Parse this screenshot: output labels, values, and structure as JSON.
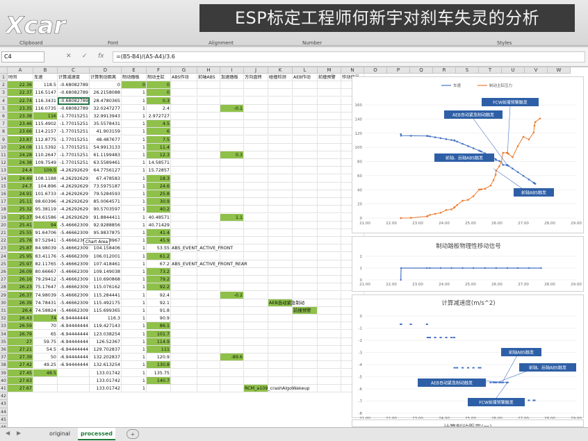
{
  "watermark": {
    "brand": "Xcar 爱卡",
    "title": "ESP标定工程师何新宇对刹车失灵的分析"
  },
  "ribbon": {
    "groups": [
      "Clipboard",
      "Font",
      "Alignment",
      "Number",
      "Styles"
    ]
  },
  "formula_bar": {
    "name_box": "C4",
    "cancel": "✕",
    "enter": "✓",
    "fx": "fx",
    "formula": "=(B5-B4)/(A5-A4)/3.6"
  },
  "columns": [
    "A",
    "B",
    "C",
    "D",
    "E",
    "F",
    "G",
    "H",
    "I",
    "J",
    "K",
    "L",
    "M",
    "N",
    "O",
    "P",
    "Q",
    "R",
    "S",
    "T",
    "U",
    "V",
    "W"
  ],
  "headers": [
    "时间",
    "车速",
    "计算减速度",
    "计算制动距离",
    "制动踏板",
    "制动主缸",
    "ABS作动",
    "前轴ABS",
    "加速踏板",
    "方向盘转",
    "碰撞检测",
    "AEB作动",
    "前撞预警",
    "作动信号"
  ],
  "rows": [
    {
      "a": "22.36",
      "b": "118.5",
      "c": "-0.68082789",
      "d": "0",
      "e": "0",
      "f": "0",
      "gA": 1,
      "gE": 1,
      "gF": 1
    },
    {
      "a": "22.37",
      "b": "116.5147",
      "c": "-0.68082789",
      "d": "26.2158088",
      "e": "1",
      "f": "0",
      "gA": 1,
      "gF": 1
    },
    {
      "a": "22.74",
      "b": "116.3431",
      "c": "-0.68082789",
      "d": "28.4780365",
      "e": "1",
      "f": "0.3",
      "gA": 1,
      "gF": 1
    },
    {
      "a": "23.35",
      "b": "116.0735",
      "c": "-0.68082789",
      "d": "32.0247277",
      "e": "1",
      "f": "2.4",
      "i": "-0.1",
      "gA": 1,
      "gI": 1
    },
    {
      "a": "23.38",
      "b": "116",
      "c": "-1.77015251",
      "d": "32.9913943",
      "e": "1",
      "f": "2.972727",
      "gA": 1,
      "gB": 1
    },
    {
      "a": "23.46",
      "b": "115.4902",
      "c": "-1.77015251",
      "d": "35.5578431",
      "e": "1",
      "f": "4.5",
      "gA": 1,
      "gF": 1
    },
    {
      "a": "23.66",
      "b": "114.2157",
      "c": "-1.77015251",
      "d": "41.903159",
      "e": "1",
      "f": "6",
      "gA": 1,
      "gF": 1
    },
    {
      "a": "23.87",
      "b": "112.8775",
      "c": "-1.77015251",
      "d": "48.487677",
      "e": "1",
      "f": "7.5",
      "gA": 1,
      "gF": 1
    },
    {
      "a": "24.08",
      "b": "111.5392",
      "c": "-1.77015251",
      "d": "54.9913133",
      "e": "1",
      "f": "11.4",
      "gA": 1,
      "gF": 1
    },
    {
      "a": "24.28",
      "b": "110.2647",
      "c": "-1.77015251",
      "d": "61.1199483",
      "e": "1",
      "f": "12.3",
      "i": "0.3",
      "gA": 1,
      "gF": 1,
      "gI": 1
    },
    {
      "a": "24.38",
      "b": "109.7549",
      "c": "-1.77015251",
      "d": "63.5589461",
      "e": "1",
      "f": "14.58571",
      "gA": 1
    },
    {
      "a": "24.4",
      "b": "109.5",
      "c": "-4.26292629",
      "d": "64.7756127",
      "e": "1",
      "f": "15.72857",
      "gA": 1,
      "gB": 1
    },
    {
      "a": "24.49",
      "b": "108.1188",
      "c": "-4.26292629",
      "d": "67.478583",
      "e": "1",
      "f": "18.3",
      "gA": 1,
      "gF": 1
    },
    {
      "a": "24.7",
      "b": "104.896",
      "c": "-4.26292629",
      "d": "73.5975187",
      "e": "1",
      "f": "24.6",
      "gA": 1,
      "gF": 1
    },
    {
      "a": "24.91",
      "b": "101.6733",
      "c": "-4.26292629",
      "d": "79.5284593",
      "e": "1",
      "f": "25.8",
      "gA": 1,
      "gF": 1
    },
    {
      "a": "25.11",
      "b": "98.60396",
      "c": "-4.26292629",
      "d": "85.0064571",
      "e": "1",
      "f": "30.9",
      "gA": 1,
      "gF": 1
    },
    {
      "a": "25.32",
      "b": "95.38119",
      "c": "-4.26292629",
      "d": "90.5703597",
      "e": "1",
      "f": "40.2",
      "gA": 1,
      "gF": 1
    },
    {
      "a": "25.37",
      "b": "94.61586",
      "c": "-4.26292629",
      "d": "91.8844411",
      "e": "1",
      "f": "40.48571",
      "i": "1.1",
      "gA": 1,
      "gI": 1
    },
    {
      "a": "25.41",
      "b": "94",
      "c": "-5.46662309",
      "d": "92.9288856",
      "e": "1",
      "f": "40.71429",
      "gA": 1,
      "gB": 1
    },
    {
      "a": "25.55",
      "b": "91.64706",
      "c": "-5.46662309",
      "d": "95.9837875",
      "e": "1",
      "f": "41.4",
      "gA": 1,
      "gF": 1
    },
    {
      "a": "25.76",
      "b": "87.52941",
      "c": "-5.46662309",
      "d": "101.08967",
      "e": "1",
      "f": "45.9",
      "gA": 1,
      "gF": 1
    },
    {
      "a": "25.87",
      "b": "84.98039",
      "c": "-5.46662309",
      "d": "104.158406",
      "e": "1",
      "f": "53.55",
      "g": "ABS_EVENT_ACTIVE_FRONT",
      "gA": 1
    },
    {
      "a": "25.95",
      "b": "83.41176",
      "c": "-5.46662309",
      "d": "106.012001",
      "e": "1",
      "f": "61.2",
      "gA": 1,
      "gF": 1
    },
    {
      "a": "25.97",
      "b": "82.11765",
      "c": "-5.46662309",
      "d": "107.418461",
      "e": "1",
      "f": "67.2",
      "g": "ABS_EVENT_ACTIVE_FRONT_REAR",
      "gA": 1
    },
    {
      "a": "26.09",
      "b": "80.66667",
      "c": "-5.46662309",
      "d": "109.149038",
      "e": "1",
      "f": "73.2",
      "gA": 1,
      "gF": 1
    },
    {
      "a": "26.16",
      "b": "79.29412",
      "c": "-5.46662309",
      "d": "110.690868",
      "e": "1",
      "f": "79.2",
      "gA": 1,
      "gF": 1
    },
    {
      "a": "26.23",
      "b": "75.17647",
      "c": "-5.46662309",
      "d": "115.076162",
      "e": "1",
      "f": "92.2",
      "gA": 1,
      "gF": 1
    },
    {
      "a": "26.37",
      "b": "74.98039",
      "c": "-5.46662309",
      "d": "115.284441",
      "e": "1",
      "f": "92.4",
      "i": "-0.2",
      "gA": 1,
      "gI": 1
    },
    {
      "a": "26.39",
      "b": "74.78431",
      "c": "-5.46662309",
      "d": "115.492175",
      "e": "1",
      "f": "92.1",
      "k": "AEB自动紧急制动",
      "gA": 1,
      "gK": 1
    },
    {
      "a": "26.4",
      "b": "74.58824",
      "c": "-5.46662309",
      "d": "115.699365",
      "e": "1",
      "f": "91.8",
      "l": "前撞预警",
      "gA": 1,
      "gL": 1
    },
    {
      "a": "26.43",
      "b": "74",
      "c": "-6.94444444",
      "d": "116.3",
      "e": "1",
      "f": "90.9",
      "gA": 1,
      "gB": 1
    },
    {
      "a": "26.59",
      "b": "70",
      "c": "-6.94444444",
      "d": "119.427143",
      "e": "1",
      "f": "86.1",
      "gA": 1,
      "gF": 1
    },
    {
      "a": "26.79",
      "b": "65",
      "c": "-6.94444444",
      "d": "123.038254",
      "e": "1",
      "f": "101.7",
      "gA": 1,
      "gF": 1
    },
    {
      "a": "27",
      "b": "59.75",
      "c": "-6.94444444",
      "d": "126.52367",
      "e": "1",
      "f": "114.9",
      "gA": 1,
      "gF": 1
    },
    {
      "a": "27.21",
      "b": "54.5",
      "c": "-6.94444444",
      "d": "129.702837",
      "e": "1",
      "f": "111",
      "gA": 1,
      "gF": 1
    },
    {
      "a": "27.39",
      "b": "50",
      "c": "-6.94444444",
      "d": "132.202837",
      "e": "1",
      "f": "120.9",
      "i": "-89.6",
      "gA": 1,
      "gI": 1
    },
    {
      "a": "27.42",
      "b": "49.25",
      "c": "-6.94444444",
      "d": "132.613254",
      "e": "1",
      "f": "130.8",
      "gA": 1,
      "gF": 1
    },
    {
      "a": "27.45",
      "b": "48.5",
      "c": "",
      "d": "133.01742",
      "e": "1",
      "f": "135.75",
      "gA": 1,
      "gB": 1
    },
    {
      "a": "27.63",
      "b": "",
      "c": "",
      "d": "133.01742",
      "e": "1",
      "f": "140.7",
      "gA": 1,
      "gF": 1
    },
    {
      "a": "27.67",
      "b": "",
      "c": "",
      "d": "133.01742",
      "e": "1",
      "f": "",
      "j": "RCM_a109_crashAlgoWakeup",
      "gA": 1,
      "gJ": 1
    }
  ],
  "tooltip": "Chart Area",
  "sheet_tabs": {
    "tabs": [
      "original",
      "processed"
    ],
    "active": "processed",
    "add": "+"
  },
  "chart_data": [
    {
      "type": "line",
      "title": "",
      "legend": [
        "车速",
        "制动主缸压力"
      ],
      "xlim": [
        21,
        29
      ],
      "ylim": [
        0,
        160
      ],
      "x_ticks": [
        "21.00",
        "22.00",
        "23.00",
        "24.00",
        "25.00",
        "26.00",
        "27.00",
        "28.00",
        "29.00"
      ],
      "y_ticks": [
        "0",
        "20",
        "40",
        "60",
        "80",
        "100",
        "120",
        "140",
        "160"
      ],
      "series": [
        {
          "name": "车速",
          "color": "#4472c4",
          "x": [
            22.36,
            22.37,
            22.74,
            23.35,
            23.38,
            23.46,
            23.66,
            23.87,
            24.08,
            24.28,
            24.38,
            24.4,
            24.49,
            24.7,
            24.91,
            25.11,
            25.32,
            25.37,
            25.41,
            25.55,
            25.76,
            25.87,
            25.95,
            25.97,
            26.09,
            26.16,
            26.23,
            26.37,
            26.39,
            26.4,
            26.43,
            26.59,
            26.79,
            27,
            27.21,
            27.39,
            27.42,
            27.45
          ],
          "y": [
            118.5,
            116.5,
            116.3,
            116.1,
            116,
            115.5,
            114.2,
            112.9,
            111.5,
            110.3,
            109.8,
            109.5,
            108.1,
            104.9,
            101.7,
            98.6,
            95.4,
            94.6,
            94,
            91.6,
            87.5,
            85,
            83.4,
            82.1,
            80.7,
            79.3,
            75.2,
            75,
            74.8,
            74.6,
            74,
            70,
            65,
            59.75,
            54.5,
            50,
            49.25,
            48.5
          ]
        },
        {
          "name": "制动主缸压力",
          "color": "#ed7d31",
          "x": [
            22.36,
            22.37,
            22.74,
            23.35,
            23.38,
            23.46,
            23.66,
            23.87,
            24.08,
            24.28,
            24.38,
            24.4,
            24.49,
            24.7,
            24.91,
            25.11,
            25.32,
            25.37,
            25.41,
            25.55,
            25.76,
            25.87,
            25.95,
            25.97,
            26.09,
            26.16,
            26.23,
            26.37,
            26.39,
            26.4,
            26.43,
            26.59,
            26.79,
            27,
            27.21,
            27.39,
            27.42,
            27.45,
            27.63
          ],
          "y": [
            0,
            0,
            0.3,
            2.4,
            2.97,
            4.5,
            6,
            7.5,
            11.4,
            12.3,
            14.6,
            15.7,
            18.3,
            24.6,
            25.8,
            30.9,
            40.2,
            40.5,
            40.7,
            41.4,
            45.9,
            53.55,
            61.2,
            67.2,
            73.2,
            79.2,
            92.2,
            92.4,
            92.1,
            91.8,
            90.9,
            86.1,
            101.7,
            114.9,
            111,
            120.9,
            130.8,
            135.75,
            140.7
          ]
        }
      ],
      "annotations": [
        "FCW前撞预警触发",
        "AEB自动紧急制动触发",
        "前轴、后轴ABS触发",
        "前轴ABS触发"
      ]
    },
    {
      "type": "line",
      "title": "制动踏板物理性移动信号",
      "xlim": [
        21,
        29
      ],
      "ylim": [
        0,
        2
      ],
      "x_ticks": [
        "21.00",
        "22.00",
        "23.00",
        "24.00",
        "25.00",
        "26.00",
        "27.00",
        "28.00",
        "29.00"
      ],
      "y_ticks": [
        "0",
        "1",
        "2"
      ],
      "series": [
        {
          "name": "",
          "color": "#4472c4",
          "x": [
            22.36,
            22.37,
            23.35,
            23.46,
            23.87,
            24.28,
            24.7,
            25.11,
            25.55,
            25.97,
            26.4,
            26.79,
            27.21,
            27.67
          ],
          "y": [
            0,
            1,
            1,
            1,
            1,
            1,
            1,
            1,
            1,
            1,
            1,
            1,
            1,
            1
          ]
        }
      ]
    },
    {
      "type": "scatter",
      "title": "计算减速度(m/s^2)",
      "xlim": [
        21,
        29
      ],
      "ylim": [
        -8,
        0
      ],
      "x_ticks": [
        "21.00",
        "22.00",
        "23.00",
        "24.00",
        "25.00",
        "26.00",
        "27.00",
        "28.00",
        "29.00"
      ],
      "y_ticks": [
        "0",
        "-1",
        "-2",
        "-3",
        "-4",
        "-5",
        "-6",
        "-7",
        "-8"
      ],
      "series": [
        {
          "name": "",
          "color": "#4472c4",
          "x": [
            22.36,
            22.37,
            22.74,
            23.35,
            23.38,
            23.46,
            23.66,
            23.87,
            24.08,
            24.28,
            24.38,
            24.4,
            24.49,
            24.7,
            24.91,
            25.11,
            25.32,
            25.37,
            25.41,
            25.55,
            25.76,
            25.87,
            25.95,
            25.97,
            26.09,
            26.16,
            26.23,
            26.37,
            26.39,
            26.4,
            26.43,
            26.59,
            26.79,
            27,
            27.21,
            27.39,
            27.42
          ],
          "y": [
            -0.68,
            -0.68,
            -0.68,
            -0.68,
            -1.77,
            -1.77,
            -1.77,
            -1.77,
            -1.77,
            -1.77,
            -1.77,
            -4.26,
            -4.26,
            -4.26,
            -4.26,
            -4.26,
            -4.26,
            -4.26,
            -5.47,
            -5.47,
            -5.47,
            -5.47,
            -5.47,
            -5.47,
            -5.47,
            -5.47,
            -5.47,
            -5.47,
            -5.47,
            -5.47,
            -6.94,
            -6.94,
            -6.94,
            -6.94,
            -6.94,
            -6.94,
            -6.94
          ]
        }
      ],
      "annotations": [
        "前轴ABS触发",
        "前轴、后轴ABS触发",
        "AEB自动紧急制动触发",
        "FCW前撞预警触发"
      ]
    }
  ],
  "bottom_chart_title": "计算制动距离(m)"
}
